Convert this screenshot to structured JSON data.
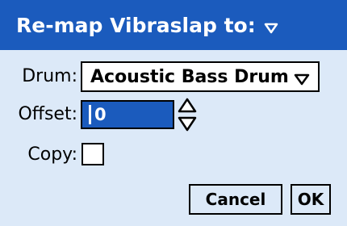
{
  "dialog": {
    "title": "Re-map Vibraslap to:",
    "title_icon": "triangle-down-icon"
  },
  "form": {
    "drum_label": "Drum:",
    "drum_value": "Acoustic Bass Drum",
    "offset_label": "Offset:",
    "offset_value": "0",
    "copy_label": "Copy:",
    "copy_checked": false
  },
  "buttons": {
    "cancel_label": "Cancel",
    "ok_label": "OK"
  },
  "colors": {
    "titlebar": "#1b5bbd",
    "background": "#dce9f8",
    "selection": "#1b5bbd"
  }
}
